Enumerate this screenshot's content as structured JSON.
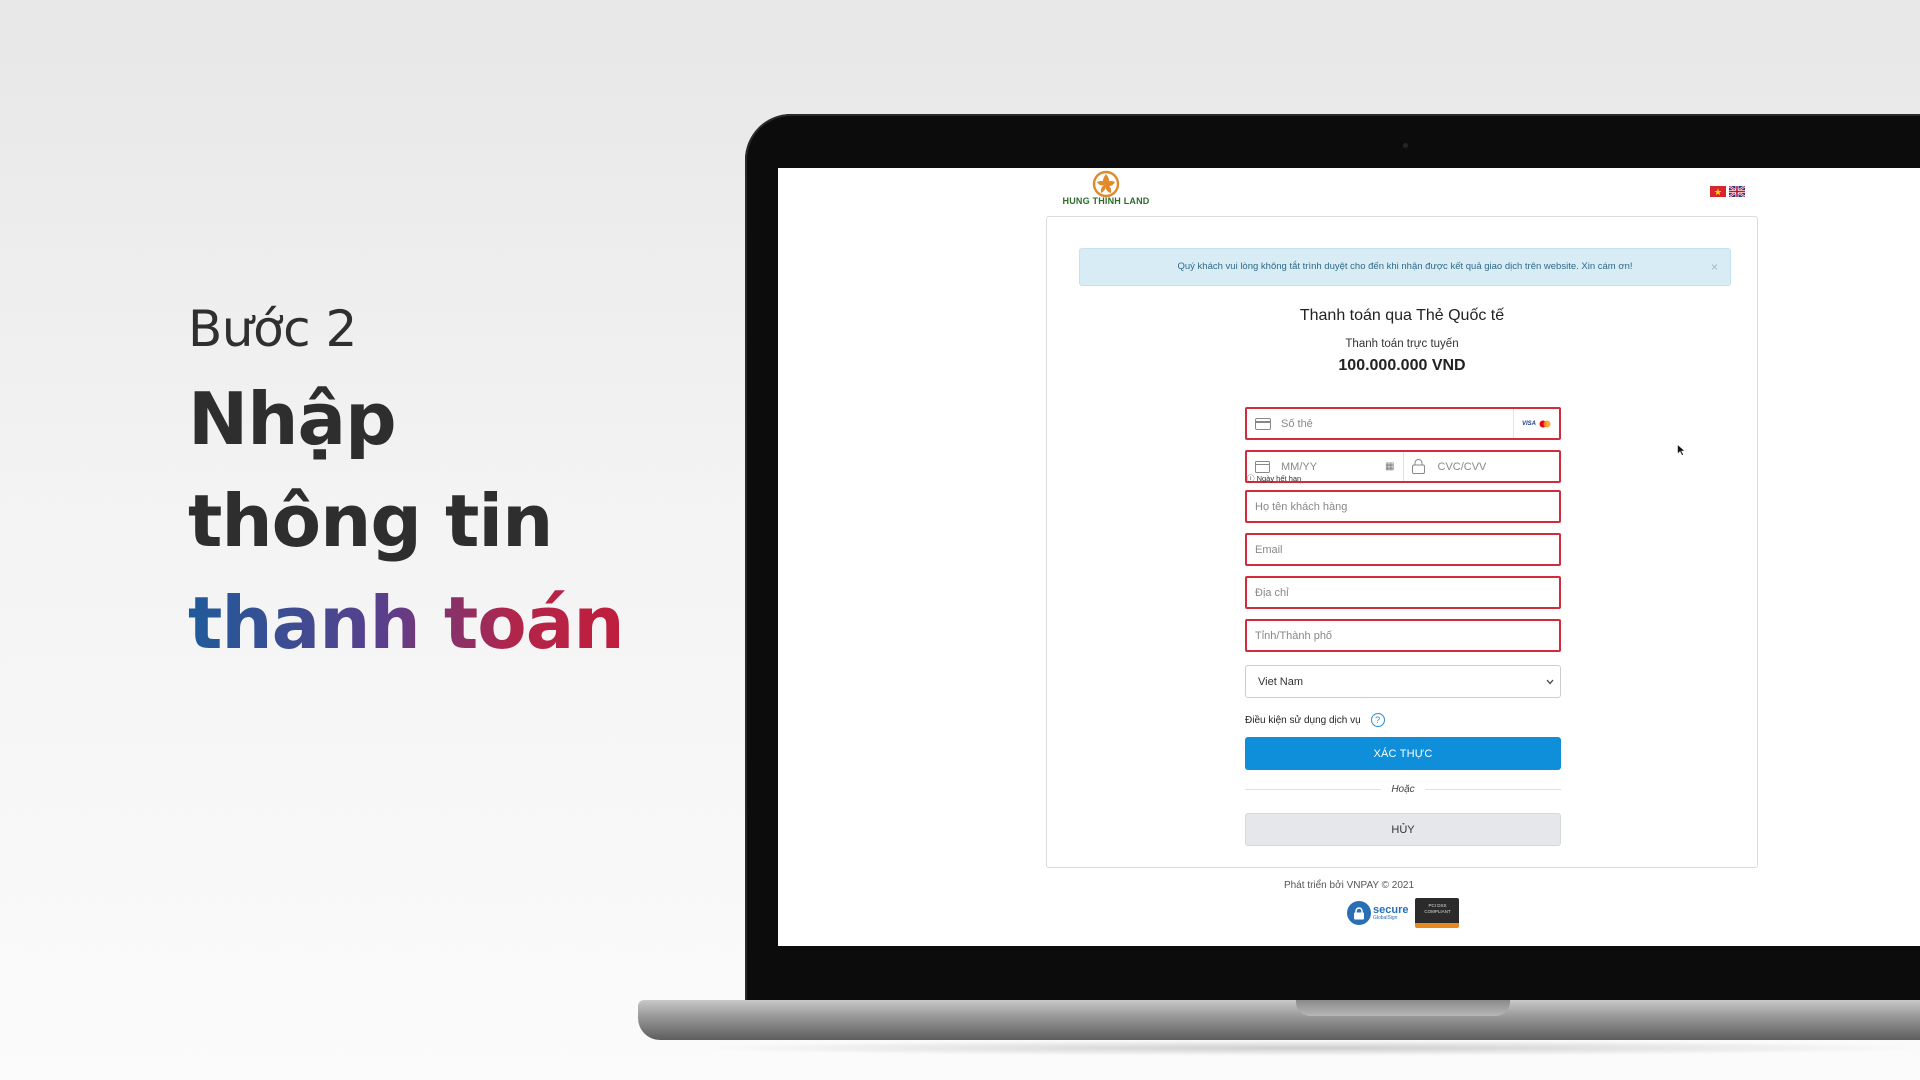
{
  "headline": {
    "step": "Bước 2",
    "line1": "Nhập",
    "line2": "thông tin",
    "line3": "thanh toán"
  },
  "payment_page": {
    "brand": "HUNG THINH LAND",
    "languages": [
      "vi-flag-icon",
      "en-flag-icon"
    ],
    "notice": "Quý khách vui lòng không tắt trình duyệt cho đến khi nhận được kết quả giao dịch trên website. Xin cám ơn!",
    "notice_close": "×",
    "title": "Thanh toán qua Thẻ Quốc tế",
    "subtitle": "Thanh toán trực tuyến",
    "amount": "100.000.000 VND",
    "fields": {
      "card_number_placeholder": "Số thẻ",
      "card_brands": "VISA",
      "expiry_placeholder": "MM/YY",
      "cvc_placeholder": "CVC/CVV",
      "expiry_hint": "Ngày hết hạn",
      "name_placeholder": "Họ tên khách hàng",
      "email_placeholder": "Email",
      "address_placeholder": "Địa chỉ",
      "city_placeholder": "Tỉnh/Thành phố",
      "country_value": "Viet Nam"
    },
    "terms_label": "Điều kiện sử dụng dịch vụ",
    "help_glyph": "?",
    "confirm_button": "XÁC THỰC",
    "or_label": "Hoặc",
    "cancel_button": "HỦY",
    "footer": "Phát triển bởi VNPAY © 2021",
    "secure_badge": "secure",
    "secure_badge_sub": "GlobalSign",
    "pci_badge": "PCI DSS COMPLIANT"
  },
  "colors": {
    "error_border": "#d22b3c",
    "primary_button": "#0f8fd9",
    "notice_bg": "#d8ecf5",
    "gradient_start": "#1f5b9a",
    "gradient_end": "#c01e3c"
  }
}
